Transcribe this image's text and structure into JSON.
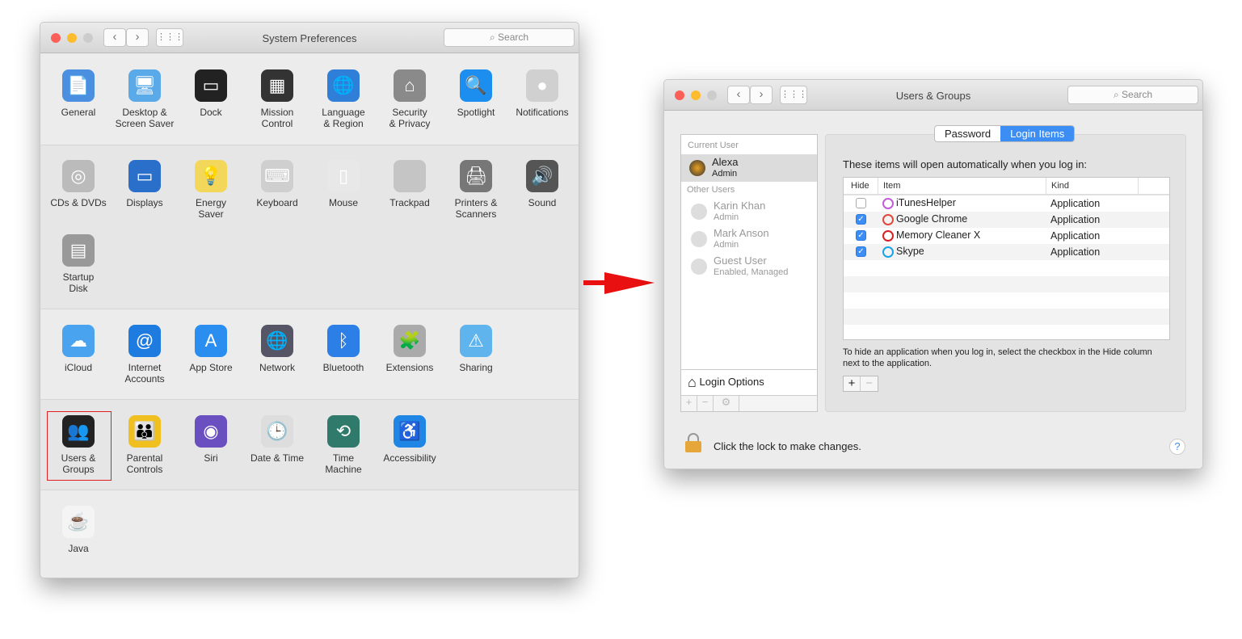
{
  "left_window": {
    "title": "System Preferences",
    "search_placeholder": "Search",
    "rows": [
      [
        {
          "label": "General",
          "icon": "general-icon",
          "color": "#4b8fe0",
          "glyph": "📄"
        },
        {
          "label": "Desktop &\nScreen Saver",
          "icon": "desktop-icon",
          "color": "#5aa9e8",
          "glyph": "🖥"
        },
        {
          "label": "Dock",
          "icon": "dock-icon",
          "color": "#222",
          "glyph": "▭"
        },
        {
          "label": "Mission\nControl",
          "icon": "mission-control-icon",
          "color": "#333",
          "glyph": "▦"
        },
        {
          "label": "Language\n& Region",
          "icon": "globe-flag-icon",
          "color": "#2f7fd8",
          "glyph": "🌐"
        },
        {
          "label": "Security\n& Privacy",
          "icon": "house-lock-icon",
          "color": "#8a8a8a",
          "glyph": "⌂"
        },
        {
          "label": "Spotlight",
          "icon": "spotlight-icon",
          "color": "#1b8ef0",
          "glyph": "🔍"
        },
        {
          "label": "Notifications",
          "icon": "notifications-icon",
          "color": "#d0d0d0",
          "glyph": "●"
        }
      ],
      [
        {
          "label": "CDs & DVDs",
          "icon": "disc-icon",
          "color": "#bbb",
          "glyph": "◎"
        },
        {
          "label": "Displays",
          "icon": "display-icon",
          "color": "#2a6fc9",
          "glyph": "▭"
        },
        {
          "label": "Energy\nSaver",
          "icon": "bulb-icon",
          "color": "#f3d75a",
          "glyph": "💡"
        },
        {
          "label": "Keyboard",
          "icon": "keyboard-icon",
          "color": "#cfcfcf",
          "glyph": "⌨"
        },
        {
          "label": "Mouse",
          "icon": "mouse-icon",
          "color": "#e8e8e8",
          "glyph": "▯"
        },
        {
          "label": "Trackpad",
          "icon": "trackpad-icon",
          "color": "#c5c5c5",
          "glyph": ""
        },
        {
          "label": "Printers &\nScanners",
          "icon": "printer-icon",
          "color": "#777",
          "glyph": "🖨"
        },
        {
          "label": "Sound",
          "icon": "speaker-icon",
          "color": "#555",
          "glyph": "🔊"
        }
      ],
      [
        {
          "label": "Startup\nDisk",
          "icon": "disk-icon",
          "color": "#999",
          "glyph": "▤"
        }
      ],
      [
        {
          "label": "iCloud",
          "icon": "cloud-icon",
          "color": "#4aa3ef",
          "glyph": "☁"
        },
        {
          "label": "Internet\nAccounts",
          "icon": "at-icon",
          "color": "#1e7ce0",
          "glyph": "@"
        },
        {
          "label": "App Store",
          "icon": "app-store-icon",
          "color": "#2a8ef0",
          "glyph": "A"
        },
        {
          "label": "Network",
          "icon": "network-globe-icon",
          "color": "#556",
          "glyph": "🌐"
        },
        {
          "label": "Bluetooth",
          "icon": "bluetooth-icon",
          "color": "#2b7fe6",
          "glyph": "ᛒ"
        },
        {
          "label": "Extensions",
          "icon": "puzzle-icon",
          "color": "#aaa",
          "glyph": "🧩"
        },
        {
          "label": "Sharing",
          "icon": "sharing-folder-icon",
          "color": "#5fb4ee",
          "glyph": "⚠"
        }
      ],
      [
        {
          "label": "Users &\nGroups",
          "icon": "users-icon",
          "color": "#222",
          "glyph": "👥"
        },
        {
          "label": "Parental\nControls",
          "icon": "parental-controls-icon",
          "color": "#f0c020",
          "glyph": "👪"
        },
        {
          "label": "Siri",
          "icon": "siri-icon",
          "color": "#6a4fc0",
          "glyph": "◉"
        },
        {
          "label": "Date & Time",
          "icon": "clock-calendar-icon",
          "color": "#ddd",
          "glyph": "🕒"
        },
        {
          "label": "Time\nMachine",
          "icon": "time-machine-icon",
          "color": "#2f7a6a",
          "glyph": "⟲"
        },
        {
          "label": "Accessibility",
          "icon": "accessibility-icon",
          "color": "#1f86e6",
          "glyph": "♿"
        }
      ],
      [
        {
          "label": "Java",
          "icon": "java-icon",
          "color": "#f4f4f4",
          "glyph": "☕"
        }
      ]
    ]
  },
  "right_window": {
    "title": "Users & Groups",
    "search_placeholder": "Search",
    "sidebar": {
      "current_header": "Current User",
      "current": {
        "name": "Alexa",
        "role": "Admin"
      },
      "other_header": "Other Users",
      "others": [
        {
          "name": "Karin Khan",
          "role": "Admin"
        },
        {
          "name": "Mark Anson",
          "role": "Admin"
        },
        {
          "name": "Guest User",
          "role": "Enabled, Managed"
        }
      ],
      "login_options": "Login Options",
      "add": "+",
      "remove": "−",
      "gear": "⚙"
    },
    "tabs": [
      "Password",
      "Login Items"
    ],
    "active_tab": "Login Items",
    "intro": "These items will open automatically when you log in:",
    "columns": [
      "Hide",
      "Item",
      "Kind"
    ],
    "items": [
      {
        "hide": false,
        "name": "iTunesHelper",
        "kind": "Application",
        "icon": "itunes-icon",
        "color": "#c25cd6"
      },
      {
        "hide": true,
        "name": "Google Chrome",
        "kind": "Application",
        "icon": "chrome-icon",
        "color": "#e0483a"
      },
      {
        "hide": true,
        "name": "Memory Cleaner X",
        "kind": "Application",
        "icon": "memory-cleaner-icon",
        "color": "#d82020"
      },
      {
        "hide": true,
        "name": "Skype",
        "kind": "Application",
        "icon": "skype-icon",
        "color": "#1aa1e6"
      }
    ],
    "hint": "To hide an application when you log in, select the checkbox in the Hide column next to the application.",
    "add": "+",
    "remove": "−",
    "lock_text": "Click the lock to make changes.",
    "help": "?"
  },
  "colors": {
    "accent": "#3c8ef5",
    "highlight_border": "#e02020",
    "arrow": "#e81010"
  }
}
